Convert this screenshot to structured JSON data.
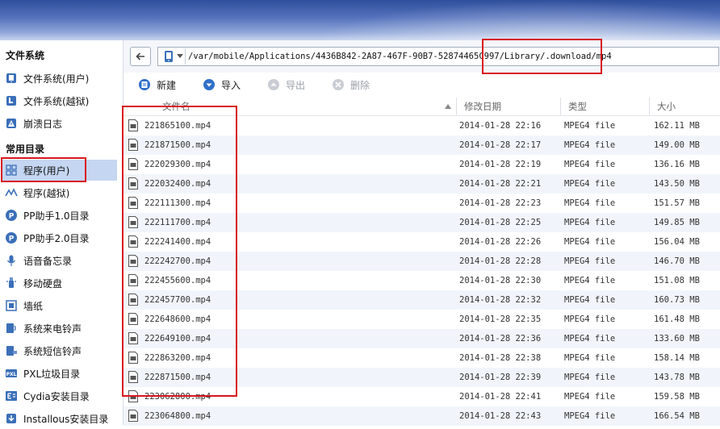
{
  "sidebar": {
    "section1_title": "文件系统",
    "section2_title": "常用目录",
    "items": [
      {
        "label": "文件系统(用户)",
        "icon": "phone-user-icon"
      },
      {
        "label": "文件系统(越狱)",
        "icon": "phone-jailbreak-icon"
      },
      {
        "label": "崩溃日志",
        "icon": "warning-icon"
      },
      {
        "label": "程序(用户)",
        "icon": "app-grid-icon",
        "active": true
      },
      {
        "label": "程序(越狱)",
        "icon": "jailbreak-app-icon"
      },
      {
        "label": "PP助手1.0目录",
        "icon": "pp-icon"
      },
      {
        "label": "PP助手2.0目录",
        "icon": "pp-icon"
      },
      {
        "label": "语音备忘录",
        "icon": "microphone-icon"
      },
      {
        "label": "移动硬盘",
        "icon": "usb-drive-icon"
      },
      {
        "label": "墙纸",
        "icon": "wallpaper-icon"
      },
      {
        "label": "系统来电铃声",
        "icon": "ringtone-icon"
      },
      {
        "label": "系统短信铃声",
        "icon": "sms-tone-icon"
      },
      {
        "label": "PXL垃圾目录",
        "icon": "pxl-icon"
      },
      {
        "label": "Cydia安装目录",
        "icon": "cydia-icon"
      },
      {
        "label": "Installous安装目录",
        "icon": "installous-icon"
      }
    ]
  },
  "address": {
    "path": "/var/mobile/Applications/4436B842-2A87-467F-90B7-52874465C997/Library/.download/mp4"
  },
  "toolbar": {
    "new_label": "新建",
    "import_label": "导入",
    "export_label": "导出",
    "delete_label": "删除"
  },
  "table": {
    "columns": [
      "文件名",
      "修改日期",
      "类型",
      "大小"
    ],
    "rows": [
      {
        "name": "221865100.mp4",
        "date": "2014-01-28 22:16",
        "type": "MPEG4 file",
        "size": "162.11 MB"
      },
      {
        "name": "221871500.mp4",
        "date": "2014-01-28 22:17",
        "type": "MPEG4 file",
        "size": "149.00 MB"
      },
      {
        "name": "222029300.mp4",
        "date": "2014-01-28 22:19",
        "type": "MPEG4 file",
        "size": "136.16 MB"
      },
      {
        "name": "222032400.mp4",
        "date": "2014-01-28 22:21",
        "type": "MPEG4 file",
        "size": "143.50 MB"
      },
      {
        "name": "222111300.mp4",
        "date": "2014-01-28 22:23",
        "type": "MPEG4 file",
        "size": "151.57 MB"
      },
      {
        "name": "222111700.mp4",
        "date": "2014-01-28 22:25",
        "type": "MPEG4 file",
        "size": "149.85 MB"
      },
      {
        "name": "222241400.mp4",
        "date": "2014-01-28 22:26",
        "type": "MPEG4 file",
        "size": "156.04 MB"
      },
      {
        "name": "222242700.mp4",
        "date": "2014-01-28 22:28",
        "type": "MPEG4 file",
        "size": "146.70 MB"
      },
      {
        "name": "222455600.mp4",
        "date": "2014-01-28 22:30",
        "type": "MPEG4 file",
        "size": "151.08 MB"
      },
      {
        "name": "222457700.mp4",
        "date": "2014-01-28 22:32",
        "type": "MPEG4 file",
        "size": "160.73 MB"
      },
      {
        "name": "222648600.mp4",
        "date": "2014-01-28 22:35",
        "type": "MPEG4 file",
        "size": "161.48 MB"
      },
      {
        "name": "222649100.mp4",
        "date": "2014-01-28 22:36",
        "type": "MPEG4 file",
        "size": "133.60 MB"
      },
      {
        "name": "222863200.mp4",
        "date": "2014-01-28 22:38",
        "type": "MPEG4 file",
        "size": "158.14 MB"
      },
      {
        "name": "222871500.mp4",
        "date": "2014-01-28 22:39",
        "type": "MPEG4 file",
        "size": "143.78 MB"
      },
      {
        "name": "223062800.mp4",
        "date": "2014-01-28 22:41",
        "type": "MPEG4 file",
        "size": "159.58 MB"
      },
      {
        "name": "223064800.mp4",
        "date": "2014-01-28 22:43",
        "type": "MPEG4 file",
        "size": "166.54 MB"
      }
    ]
  },
  "colors": {
    "highlight_red": "#d8171f",
    "selected_bg": "#c5d6f2",
    "accent_blue": "#2f6fc9"
  }
}
